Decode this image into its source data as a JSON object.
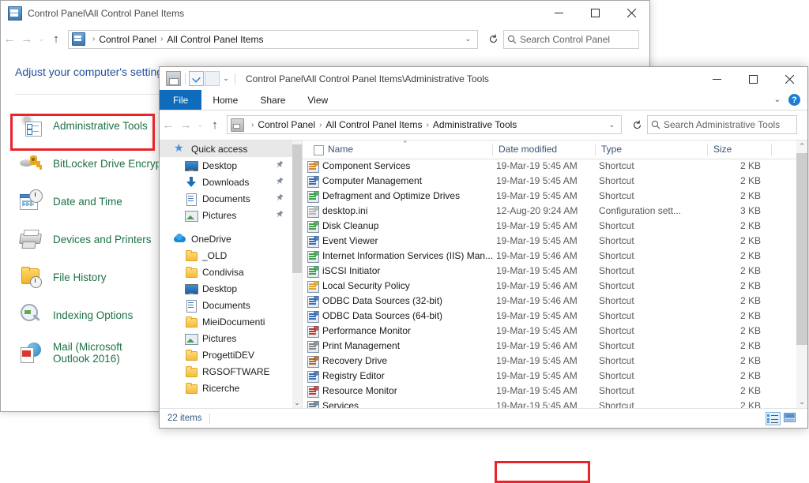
{
  "control_panel": {
    "title": "Control Panel\\All Control Panel Items",
    "title_icon": "control-panel-icon",
    "breadcrumbs": [
      "Control Panel",
      "All Control Panel Items"
    ],
    "search_placeholder": "Search Control Panel",
    "heading": "Adjust your computer's settings",
    "window_buttons": {
      "minimize": "minimize",
      "maximize": "maximize",
      "close": "close"
    },
    "items": [
      {
        "label": "Administrative Tools",
        "icon": "administrative-tools-icon",
        "highlighted": true
      },
      {
        "label": "BitLocker Drive Encrypt",
        "icon": "bitlocker-icon",
        "highlighted": false
      },
      {
        "label": "Date and Time",
        "icon": "date-and-time-icon",
        "highlighted": false
      },
      {
        "label": "Devices and Printers",
        "icon": "devices-and-printers-icon",
        "highlighted": false
      },
      {
        "label": "File History",
        "icon": "file-history-icon",
        "highlighted": false
      },
      {
        "label": "Indexing Options",
        "icon": "indexing-options-icon",
        "highlighted": false
      },
      {
        "label": "Mail (Microsoft Outlook 2016)",
        "icon": "mail-icon",
        "highlighted": false
      }
    ],
    "highlight_color": "#e8232a",
    "link_color": "#1e7145",
    "heading_color": "#1f4e9c"
  },
  "explorer": {
    "title": "Control Panel\\All Control Panel Items\\Administrative Tools",
    "quick_access_toolbar": [
      "admin-tools-icon",
      "properties-icon",
      "new-folder-icon",
      "customize-dropdown-icon"
    ],
    "window_buttons": {
      "minimize": "minimize",
      "maximize": "maximize",
      "close": "close"
    },
    "ribbon_tabs": [
      {
        "label": "File",
        "active": true
      },
      {
        "label": "Home",
        "active": false
      },
      {
        "label": "Share",
        "active": false
      },
      {
        "label": "View",
        "active": false
      }
    ],
    "ribbon_collapse_icon": "chevron-down-icon",
    "help_icon": "help-icon",
    "breadcrumbs": [
      "Control Panel",
      "All Control Panel Items",
      "Administrative Tools"
    ],
    "search_placeholder": "Search Administrative Tools",
    "refresh_icon": "refresh-icon",
    "nav_pane": [
      {
        "label": "Quick access",
        "icon": "star-icon",
        "level": 1,
        "selected": true,
        "pinned": false
      },
      {
        "label": "Desktop",
        "icon": "desktop-icon",
        "level": 2,
        "selected": false,
        "pinned": true
      },
      {
        "label": "Downloads",
        "icon": "downloads-icon",
        "level": 2,
        "selected": false,
        "pinned": true
      },
      {
        "label": "Documents",
        "icon": "documents-icon",
        "level": 2,
        "selected": false,
        "pinned": true
      },
      {
        "label": "Pictures",
        "icon": "pictures-icon",
        "level": 2,
        "selected": false,
        "pinned": true
      },
      {
        "label": "OneDrive",
        "icon": "onedrive-icon",
        "level": 1,
        "selected": false,
        "pinned": false,
        "gap_before": true
      },
      {
        "label": "_OLD",
        "icon": "folder-icon",
        "level": 2,
        "selected": false,
        "pinned": false
      },
      {
        "label": "Condivisa",
        "icon": "folder-icon",
        "level": 2,
        "selected": false,
        "pinned": false
      },
      {
        "label": "Desktop",
        "icon": "desktop-icon",
        "level": 2,
        "selected": false,
        "pinned": false
      },
      {
        "label": "Documents",
        "icon": "documents-icon",
        "level": 2,
        "selected": false,
        "pinned": false
      },
      {
        "label": "MieiDocumenti",
        "icon": "folder-icon",
        "level": 2,
        "selected": false,
        "pinned": false
      },
      {
        "label": "Pictures",
        "icon": "pictures-icon",
        "level": 2,
        "selected": false,
        "pinned": false
      },
      {
        "label": "ProgettiDEV",
        "icon": "folder-icon",
        "level": 2,
        "selected": false,
        "pinned": false
      },
      {
        "label": "RGSOFTWARE",
        "icon": "folder-icon",
        "level": 2,
        "selected": false,
        "pinned": false
      },
      {
        "label": "Ricerche",
        "icon": "folder-icon",
        "level": 2,
        "selected": false,
        "pinned": false
      }
    ],
    "columns": [
      {
        "key": "name",
        "label": "Name",
        "sorted": true,
        "sort_dir": "asc"
      },
      {
        "key": "date",
        "label": "Date modified"
      },
      {
        "key": "type",
        "label": "Type"
      },
      {
        "key": "size",
        "label": "Size"
      }
    ],
    "files": [
      {
        "name": "Component Services",
        "date": "19-Mar-19 5:45 AM",
        "type": "Shortcut",
        "size": "2 KB",
        "icon": "component-services-icon",
        "highlighted": false
      },
      {
        "name": "Computer Management",
        "date": "19-Mar-19 5:45 AM",
        "type": "Shortcut",
        "size": "2 KB",
        "icon": "computer-management-icon",
        "highlighted": false
      },
      {
        "name": "Defragment and Optimize Drives",
        "date": "19-Mar-19 5:45 AM",
        "type": "Shortcut",
        "size": "2 KB",
        "icon": "defragment-icon",
        "highlighted": false
      },
      {
        "name": "desktop.ini",
        "date": "12-Aug-20 9:24 AM",
        "type": "Configuration sett...",
        "size": "3 KB",
        "icon": "config-file-icon",
        "highlighted": false
      },
      {
        "name": "Disk Cleanup",
        "date": "19-Mar-19 5:45 AM",
        "type": "Shortcut",
        "size": "2 KB",
        "icon": "disk-cleanup-icon",
        "highlighted": false
      },
      {
        "name": "Event Viewer",
        "date": "19-Mar-19 5:45 AM",
        "type": "Shortcut",
        "size": "2 KB",
        "icon": "event-viewer-icon",
        "highlighted": false
      },
      {
        "name": "Internet Information Services (IIS) Man...",
        "date": "19-Mar-19 5:46 AM",
        "type": "Shortcut",
        "size": "2 KB",
        "icon": "iis-manager-icon",
        "highlighted": false
      },
      {
        "name": "iSCSI Initiator",
        "date": "19-Mar-19 5:45 AM",
        "type": "Shortcut",
        "size": "2 KB",
        "icon": "iscsi-icon",
        "highlighted": false
      },
      {
        "name": "Local Security Policy",
        "date": "19-Mar-19 5:46 AM",
        "type": "Shortcut",
        "size": "2 KB",
        "icon": "local-security-policy-icon",
        "highlighted": false
      },
      {
        "name": "ODBC Data Sources (32-bit)",
        "date": "19-Mar-19 5:46 AM",
        "type": "Shortcut",
        "size": "2 KB",
        "icon": "odbc-icon",
        "highlighted": false
      },
      {
        "name": "ODBC Data Sources (64-bit)",
        "date": "19-Mar-19 5:45 AM",
        "type": "Shortcut",
        "size": "2 KB",
        "icon": "odbc-icon",
        "highlighted": false
      },
      {
        "name": "Performance Monitor",
        "date": "19-Mar-19 5:45 AM",
        "type": "Shortcut",
        "size": "2 KB",
        "icon": "performance-monitor-icon",
        "highlighted": false
      },
      {
        "name": "Print Management",
        "date": "19-Mar-19 5:46 AM",
        "type": "Shortcut",
        "size": "2 KB",
        "icon": "print-management-icon",
        "highlighted": false
      },
      {
        "name": "Recovery Drive",
        "date": "19-Mar-19 5:45 AM",
        "type": "Shortcut",
        "size": "2 KB",
        "icon": "recovery-drive-icon",
        "highlighted": false
      },
      {
        "name": "Registry Editor",
        "date": "19-Mar-19 5:45 AM",
        "type": "Shortcut",
        "size": "2 KB",
        "icon": "registry-editor-icon",
        "highlighted": false
      },
      {
        "name": "Resource Monitor",
        "date": "19-Mar-19 5:45 AM",
        "type": "Shortcut",
        "size": "2 KB",
        "icon": "resource-monitor-icon",
        "highlighted": false
      },
      {
        "name": "Services",
        "date": "19-Mar-19 5:45 AM",
        "type": "Shortcut",
        "size": "2 KB",
        "icon": "services-icon",
        "highlighted": true
      }
    ],
    "status": {
      "item_count": "22 items"
    },
    "view_buttons": [
      {
        "name": "details-view-button",
        "active": true
      },
      {
        "name": "large-icons-view-button",
        "active": false
      }
    ]
  }
}
